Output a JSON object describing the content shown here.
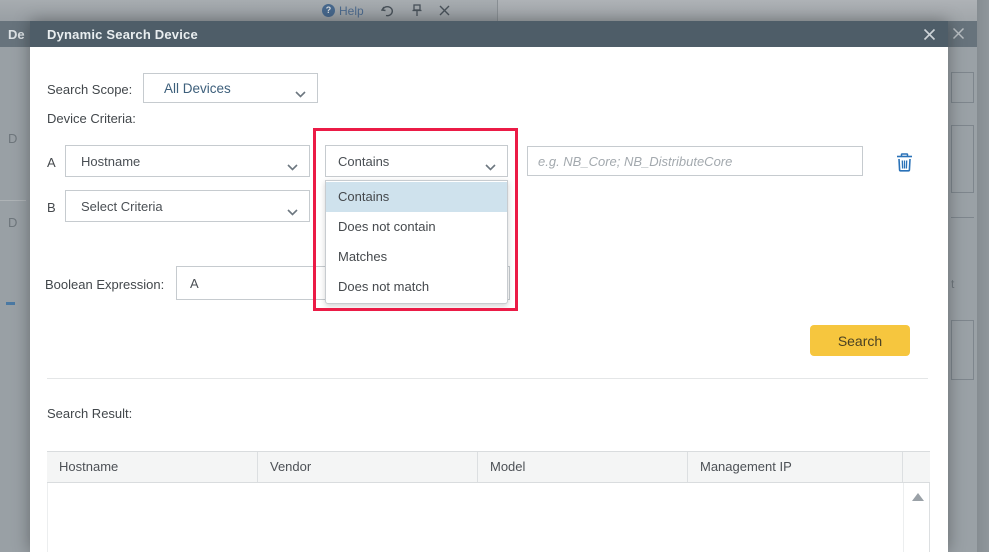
{
  "chrome": {
    "help_icon_glyph": "?",
    "help_label": "Help",
    "bg_title_fragment": "De",
    "bg_left_fragment_1": "D",
    "bg_left_fragment_2": "D",
    "bg_right_fragment": "t"
  },
  "dialog": {
    "title": "Dynamic Search Device",
    "search_scope_label": "Search Scope:",
    "search_scope_value": "All Devices",
    "device_criteria_label": "Device Criteria:",
    "rows": [
      {
        "letter": "A",
        "criteria": "Hostname",
        "operator": "Contains",
        "value_placeholder": "e.g. NB_Core; NB_DistributeCore"
      },
      {
        "letter": "B",
        "criteria": "Select Criteria"
      }
    ],
    "operator_options": [
      "Contains",
      "Does not contain",
      "Matches",
      "Does not match"
    ],
    "selected_operator_index": 0,
    "boolean_label": "Boolean Expression:",
    "boolean_value": "A",
    "search_button_label": "Search",
    "result_label": "Search Result:",
    "table_columns": [
      "Hostname",
      "Vendor",
      "Model",
      "Management IP"
    ]
  },
  "icons": {
    "help": "question-circle-icon",
    "undo": "undo-icon",
    "pin": "pin-icon",
    "close": "x-icon",
    "dropdown": "chevron-down-icon",
    "delete": "trash-icon",
    "scroll_up": "triangle-up-icon"
  },
  "colors": {
    "titlebar": "#4e5d68",
    "accent_button": "#f6c63e",
    "menu_highlight": "#cfe2ed",
    "annotation_red": "#eb1b46",
    "icon_blue": "#2a72b8",
    "backdrop": "#99a0a5"
  }
}
